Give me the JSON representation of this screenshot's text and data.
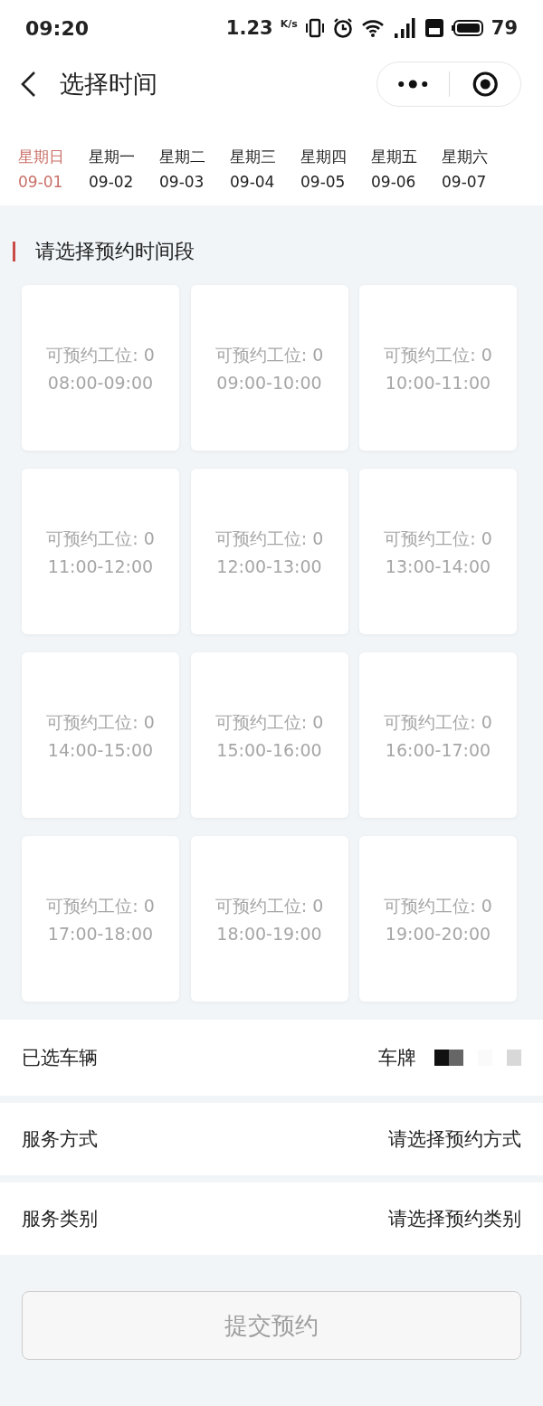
{
  "status_bar": {
    "time": "09:20",
    "speed": "1.23",
    "speed_unit": "K/s",
    "battery": "79"
  },
  "nav": {
    "title": "选择时间"
  },
  "days": [
    {
      "weekday": "星期日",
      "date": "09-01",
      "selected": true
    },
    {
      "weekday": "星期一",
      "date": "09-02",
      "selected": false
    },
    {
      "weekday": "星期二",
      "date": "09-03",
      "selected": false
    },
    {
      "weekday": "星期三",
      "date": "09-04",
      "selected": false
    },
    {
      "weekday": "星期四",
      "date": "09-05",
      "selected": false
    },
    {
      "weekday": "星期五",
      "date": "09-06",
      "selected": false
    },
    {
      "weekday": "星期六",
      "date": "09-07",
      "selected": false
    }
  ],
  "section_title": "请选择预约时间段",
  "slots": [
    {
      "capacity": "可预约工位: 0",
      "time": "08:00-09:00",
      "disabled": true
    },
    {
      "capacity": "可预约工位: 0",
      "time": "09:00-10:00",
      "disabled": true
    },
    {
      "capacity": "可预约工位: 0",
      "time": "10:00-11:00",
      "disabled": true
    },
    {
      "capacity": "可预约工位: 0",
      "time": "11:00-12:00",
      "disabled": true
    },
    {
      "capacity": "可预约工位: 0",
      "time": "12:00-13:00",
      "disabled": true
    },
    {
      "capacity": "可预约工位: 0",
      "time": "13:00-14:00",
      "disabled": true
    },
    {
      "capacity": "可预约工位: 0",
      "time": "14:00-15:00",
      "disabled": true
    },
    {
      "capacity": "可预约工位: 0",
      "time": "15:00-16:00",
      "disabled": true
    },
    {
      "capacity": "可预约工位: 0",
      "time": "16:00-17:00",
      "disabled": true
    },
    {
      "capacity": "可预约工位: 0",
      "time": "17:00-18:00",
      "disabled": true
    },
    {
      "capacity": "可预约工位: 0",
      "time": "18:00-19:00",
      "disabled": true
    },
    {
      "capacity": "可预约工位: 0",
      "time": "19:00-20:00",
      "disabled": true
    }
  ],
  "form_rows": [
    {
      "label": "已选车辆",
      "value": "车牌",
      "kind": "plate"
    },
    {
      "label": "服务方式",
      "value": "请选择预约方式",
      "kind": "select"
    },
    {
      "label": "服务类别",
      "value": "请选择预约类别",
      "kind": "select"
    }
  ],
  "submit": {
    "label": "提交预约",
    "disabled": true
  }
}
